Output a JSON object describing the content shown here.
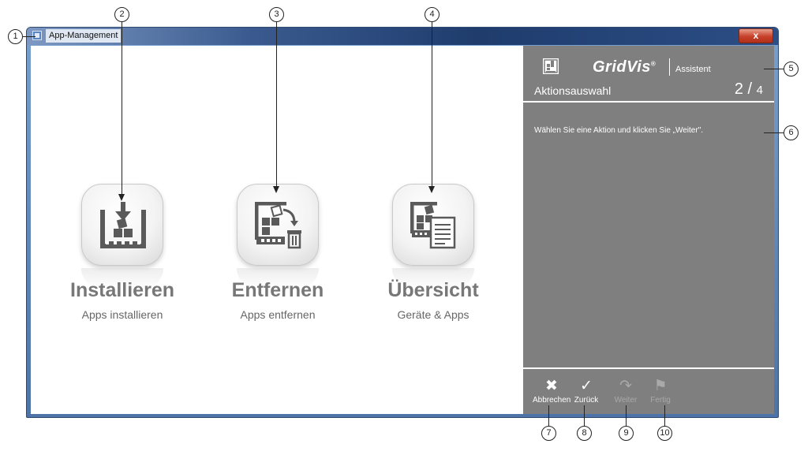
{
  "window": {
    "title": "App-Management",
    "close_glyph": "x"
  },
  "tiles": [
    {
      "icon": "install-icon",
      "title": "Installieren",
      "subtitle": "Apps installieren"
    },
    {
      "icon": "remove-icon",
      "title": "Entfernen",
      "subtitle": "Apps entfernen"
    },
    {
      "icon": "overview-icon",
      "title": "Übersicht",
      "subtitle": "Geräte & Apps"
    }
  ],
  "assistant": {
    "brand_name": "GridVis",
    "brand_reg": "®",
    "brand_sub": "Assistent",
    "step_name": "Aktionsauswahl",
    "step_current": "2",
    "step_total": "4",
    "instruction": "Wählen Sie eine Aktion und klicken Sie „Weiter\".",
    "buttons": [
      {
        "label": "Abbrechen",
        "glyph": "✖",
        "state": "active"
      },
      {
        "label": "Zurück",
        "glyph": "✓",
        "state": "active"
      },
      {
        "label": "Weiter",
        "glyph": "↷",
        "state": "disabled"
      },
      {
        "label": "Fertig",
        "glyph": "⚑",
        "state": "disabled"
      }
    ]
  },
  "callouts": [
    "1",
    "2",
    "3",
    "4",
    "5",
    "6",
    "7",
    "8",
    "9",
    "10"
  ],
  "colors": {
    "panel_bg": "#7f7f7f",
    "tile_text": "#777777",
    "titlebar_dark": "#1f3c6d"
  }
}
